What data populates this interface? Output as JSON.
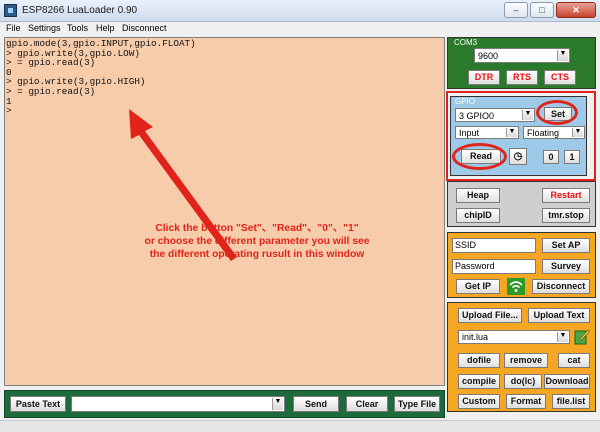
{
  "window": {
    "title": "ESP8266 LuaLoader 0.90",
    "min": "–",
    "max": "□",
    "close": "✕"
  },
  "menu": [
    "File",
    "Settings",
    "Tools",
    "Help",
    "Disconnect"
  ],
  "console": {
    "lines": [
      "gpio.mode(3,gpio.INPUT,gpio.FLOAT)",
      "> gpio.write(3,gpio.LOW)",
      "> = gpio.read(3)",
      "0",
      "> gpio.write(3,gpio.HIGH)",
      "> = gpio.read(3)",
      "1",
      ">"
    ],
    "annotation": [
      "Click the button \"Set\"、\"Read\"、\"0\"、\"1\"",
      "or choose the different parameter you will see",
      "the different operating rusult in this window"
    ]
  },
  "bottom": {
    "paste": "Paste Text",
    "send": "Send",
    "clear": "Clear",
    "type_file": "Type File"
  },
  "com": {
    "label": "COM3",
    "baud": "9600",
    "dtr": "DTR",
    "rts": "RTS",
    "cts": "CTS"
  },
  "gpio": {
    "label": "GPIO",
    "pin": "3 GPIO0",
    "set": "Set",
    "mode": "Input",
    "pull": "Floating",
    "read": "Read",
    "zero": "0",
    "one": "1"
  },
  "misc": {
    "heap": "Heap",
    "restart": "Restart",
    "chipid": "chipID",
    "tmrstop": "tmr.stop"
  },
  "wifi": {
    "ssid": "SSID",
    "password": "Password",
    "set_ap": "Set AP",
    "survey": "Survey",
    "get_ip": "Get IP",
    "disconnect": "Disconnect"
  },
  "files": {
    "upload_file": "Upload File...",
    "upload_text": "Upload Text",
    "file": "init.lua",
    "dofile": "dofile",
    "remove": "remove",
    "cat": "cat",
    "compile": "compile",
    "dolc": "do(lc)",
    "download": "Download",
    "custom": "Custom",
    "format": "Format",
    "filelist": "file.list"
  },
  "colors": {
    "console_bg": "#f7ccaa",
    "annotation": "#e1241b",
    "panel_green": "#2b7a2b",
    "panel_orange": "#f5a623",
    "panel_blue": "#9fc9e8"
  }
}
